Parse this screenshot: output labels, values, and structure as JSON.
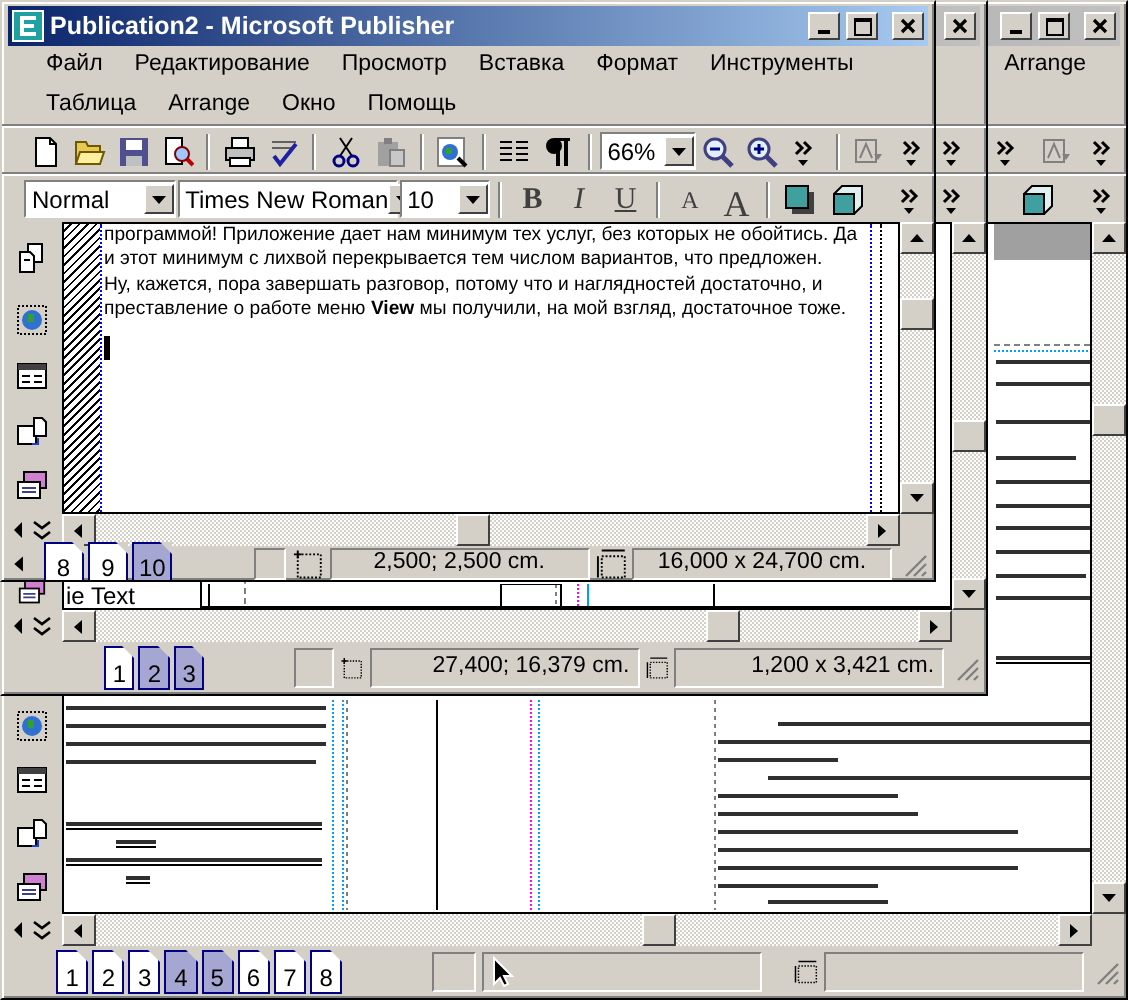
{
  "windows": [
    {
      "kind": "front",
      "title": "Publication2 - Microsoft Publisher",
      "menu": [
        [
          "Файл",
          "Редактирование",
          "Просмотр",
          "Вставка",
          "Формат",
          "Инструменты"
        ],
        [
          "Таблица",
          "Arrange",
          "Окно",
          "Помощь"
        ]
      ],
      "zoom": "66%",
      "style": "Normal",
      "font": "Times New Roman",
      "font_size": "10",
      "format_buttons": [
        {
          "label": "B",
          "kind": "bold"
        },
        {
          "label": "I",
          "kind": "italic"
        },
        {
          "label": "U",
          "kind": "underline"
        },
        {
          "label": "A",
          "kind": "shrink"
        },
        {
          "label": "A",
          "kind": "grow"
        }
      ],
      "paragraphs": [
        "программой! Приложение дает нам минимум тех услуг, без которых не обойтись. Да и этот минимум с лихвой перекрывается тем числом вариантов, что предложен.",
        "Ну, кажется, пора завершать разговор, потому что и наглядностей достаточно, и преставление о работе меню **View** мы получили, на мой взгляд, достаточное тоже."
      ],
      "pages": [
        {
          "label": "8",
          "selected": false
        },
        {
          "label": "9",
          "selected": false
        },
        {
          "label": "10",
          "selected": true
        }
      ],
      "position": "2,500; 2,500 cm.",
      "size": "16,000 x  24,700 cm."
    },
    {
      "kind": "middle",
      "fragment": "ie Text",
      "pages": [
        {
          "label": "1",
          "selected": false
        },
        {
          "label": "2",
          "selected": true
        },
        {
          "label": "3",
          "selected": true
        }
      ],
      "position": "27,400; 16,379 cm.",
      "size": "1,200 x  3,421 cm."
    },
    {
      "kind": "back",
      "menu": [
        "Arrange"
      ],
      "pages": [
        {
          "label": "1",
          "selected": false
        },
        {
          "label": "2",
          "selected": false
        },
        {
          "label": "3",
          "selected": false
        },
        {
          "label": "4",
          "selected": true
        },
        {
          "label": "5",
          "selected": true
        },
        {
          "label": "6",
          "selected": false
        },
        {
          "label": "7",
          "selected": false
        },
        {
          "label": "8",
          "selected": false
        }
      ]
    }
  ]
}
